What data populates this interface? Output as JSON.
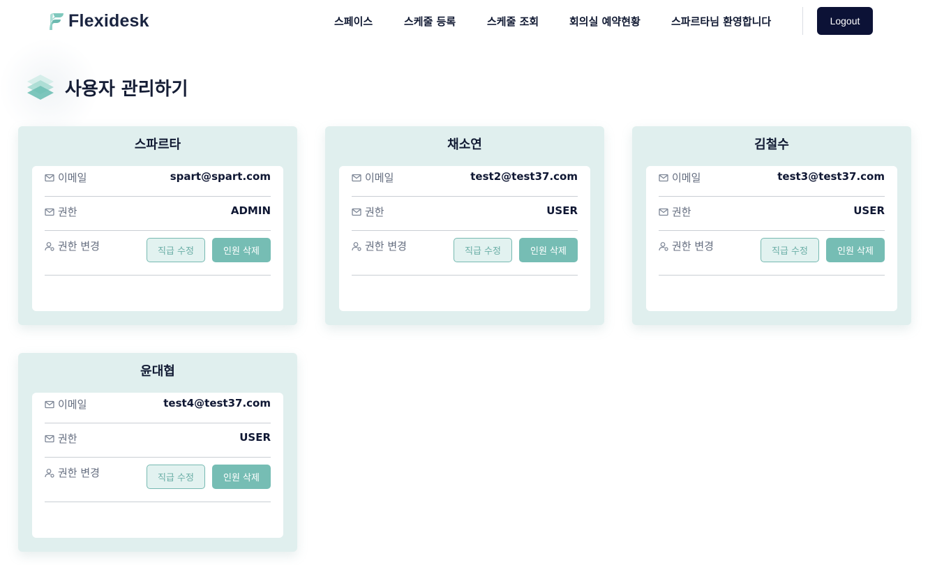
{
  "app": {
    "brand": "Flexidesk"
  },
  "nav": {
    "items": [
      "스페이스",
      "스케줄 등록",
      "스케줄 조회",
      "회의실 예약현황",
      "스파르타님 환영합니다"
    ],
    "logout_label": "Logout"
  },
  "page": {
    "title": "사용자 관리하기"
  },
  "labels": {
    "email": "이메일",
    "role": "권한",
    "change_role": "권한 변경",
    "edit_button": "직급 수정",
    "delete_button": "인원 삭제"
  },
  "users": [
    {
      "name": "스파르타",
      "email": "spart@spart.com",
      "role": "ADMIN"
    },
    {
      "name": "채소연",
      "email": "test2@test37.com",
      "role": "USER"
    },
    {
      "name": "김철수",
      "email": "test3@test37.com",
      "role": "USER"
    },
    {
      "name": "윤대협",
      "email": "test4@test37.com",
      "role": "USER"
    }
  ],
  "colors": {
    "accent": "#76bdb4",
    "card_bg": "#e0efee",
    "logout_bg": "#0c1236"
  }
}
